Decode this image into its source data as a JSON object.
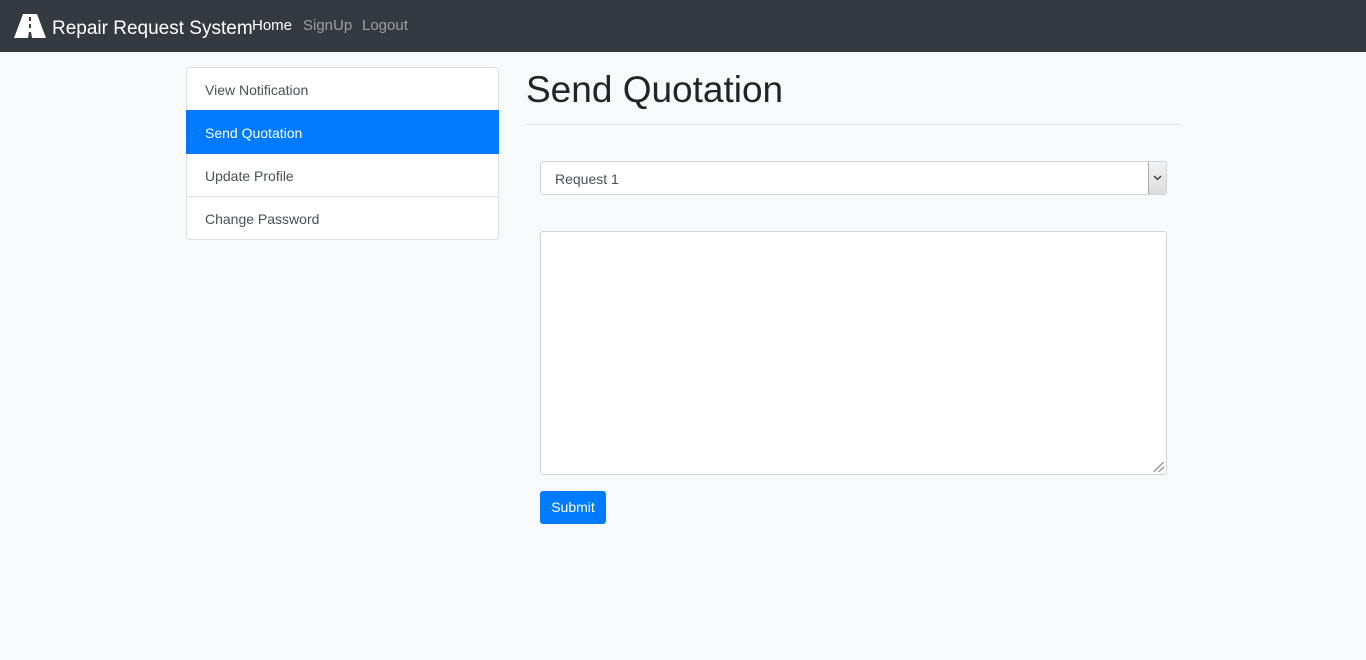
{
  "navbar": {
    "brand_text": "Repair Request System",
    "brand_icon": "road-icon",
    "links": [
      {
        "label": "Home",
        "active": true
      },
      {
        "label": "SignUp",
        "active": false
      },
      {
        "label": "Logout",
        "active": false
      }
    ]
  },
  "sidebar": {
    "items": [
      {
        "label": "View Notification",
        "active": false
      },
      {
        "label": "Send Quotation",
        "active": true
      },
      {
        "label": "Update Profile",
        "active": false
      },
      {
        "label": "Change Password",
        "active": false
      }
    ]
  },
  "main": {
    "title": "Send Quotation",
    "request_select": {
      "selected": "Request 1",
      "arrow_icon": "chevron-down-icon"
    },
    "message_textarea": {
      "value": ""
    },
    "submit_label": "Submit"
  },
  "colors": {
    "navbar_bg": "#343a40",
    "accent": "#007bff",
    "page_bg": "#f8f9fa"
  }
}
